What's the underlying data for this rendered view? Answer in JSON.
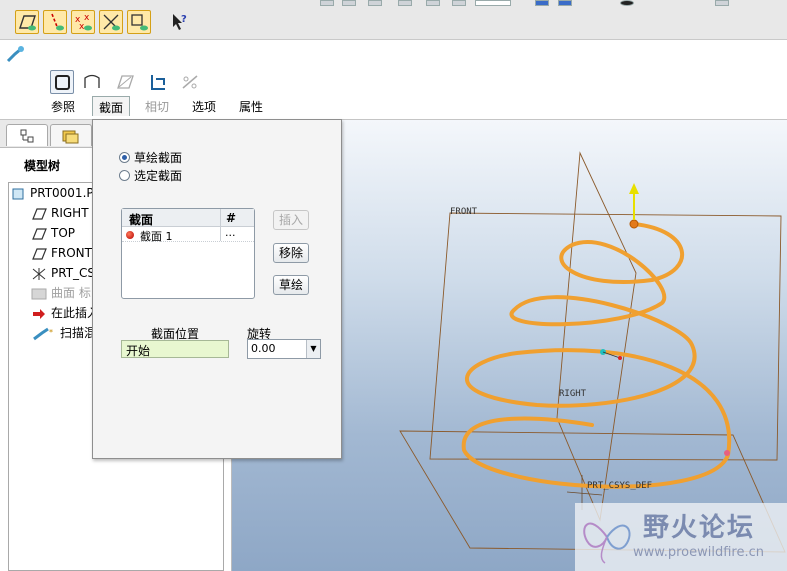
{
  "toolbar": {
    "buttons": [
      "datum-planes-icon",
      "datum-axes-icon",
      "datum-points-icon",
      "csys-icon",
      "annotation-icon",
      "whats-this-icon"
    ]
  },
  "dashboard": {
    "tabs": [
      {
        "label": "参照",
        "state": "normal"
      },
      {
        "label": "截面",
        "state": "active"
      },
      {
        "label": "相切",
        "state": "disabled"
      },
      {
        "label": "选项",
        "state": "normal"
      },
      {
        "label": "属性",
        "state": "normal"
      }
    ]
  },
  "model_tree": {
    "title": "模型树",
    "items": [
      {
        "label": "PRT0001.P",
        "icon": "part-icon"
      },
      {
        "label": "RIGHT",
        "icon": "datum-plane-icon"
      },
      {
        "label": "TOP",
        "icon": "datum-plane-icon"
      },
      {
        "label": "FRONT",
        "icon": "datum-plane-icon"
      },
      {
        "label": "PRT_CS",
        "icon": "csys-icon"
      },
      {
        "label": "曲面 标",
        "icon": "surface-icon",
        "dim": true
      },
      {
        "label": "在此插入",
        "icon": "insert-arrow-icon"
      },
      {
        "label": "扫描混",
        "icon": "swept-blend-icon"
      }
    ]
  },
  "panel": {
    "radio_sketched": "草绘截面",
    "radio_selected": "选定截面",
    "radio_selected_value": "sketched",
    "list_header_section": "截面",
    "list_header_num": "#",
    "list_row_name": "截面 1",
    "list_row_num": "...",
    "btn_insert": "插入",
    "btn_remove": "移除",
    "btn_sketch": "草绘",
    "position_label": "截面位置",
    "position_value": "开始",
    "rotation_label": "旋转",
    "rotation_value": "0.00"
  },
  "graphics": {
    "label_front": "FRONT",
    "label_right": "RIGHT",
    "label_csys": "PRT_CSYS_DEF",
    "helix_color": "#f0a030",
    "datum_color": "#8b5a2b"
  },
  "watermark": {
    "brand": "野火论坛",
    "url": "www.proewildfire.cn"
  }
}
